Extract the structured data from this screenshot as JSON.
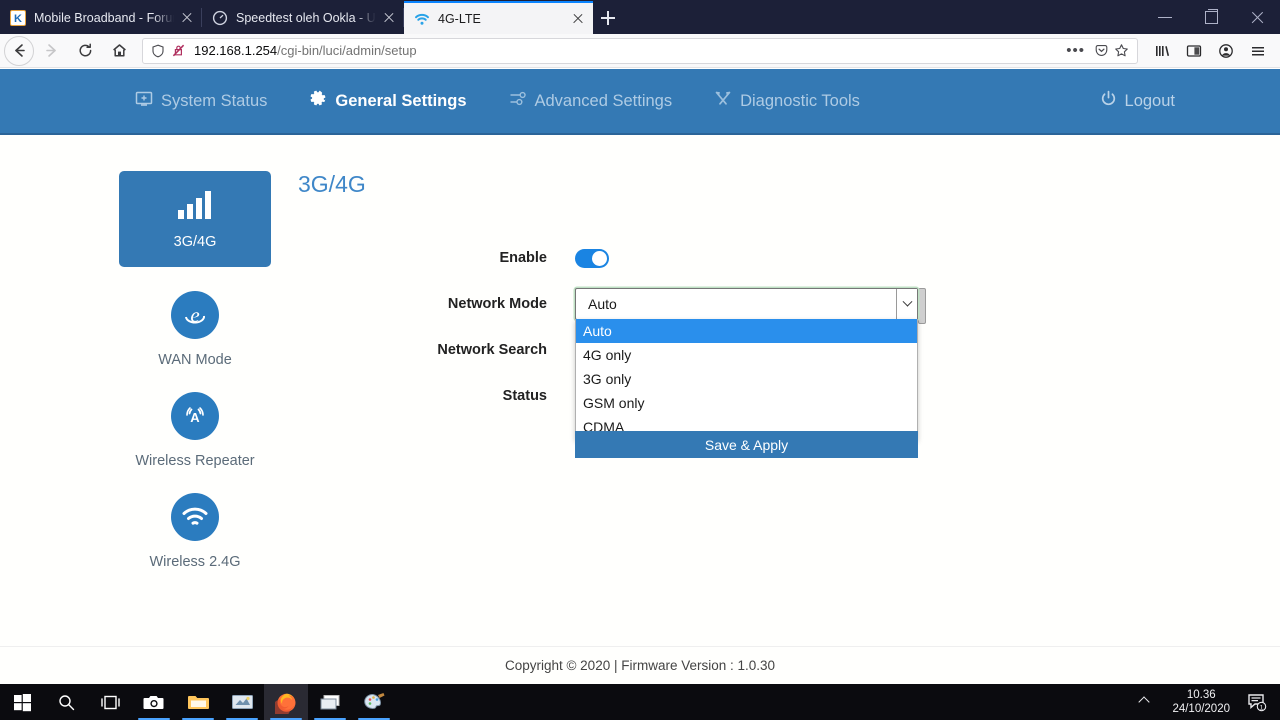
{
  "browser": {
    "tabs": [
      {
        "title": "Mobile Broadband - Forum | K",
        "favicon": "k-logo-icon",
        "active": false
      },
      {
        "title": "Speedtest oleh Ookla - Uji Kece",
        "favicon": "speedtest-icon",
        "active": false
      },
      {
        "title": "4G-LTE",
        "favicon": "wifi-icon",
        "active": true
      }
    ],
    "new_tab_label": "+",
    "window_controls": {
      "minimize": "minimize",
      "maximize": "restore",
      "close": "close"
    },
    "nav": {
      "back": "back-arrow",
      "forward": "forward-arrow",
      "reload": "reload",
      "home": "home"
    },
    "url": {
      "host": "192.168.1.254",
      "path": "/cgi-bin/luci/admin/setup",
      "shield": "shield-icon",
      "lock": "lock-broken-icon"
    },
    "toolbar_right": [
      "library-icon",
      "sidebar-icon",
      "account-icon",
      "menu-icon"
    ]
  },
  "app": {
    "nav": [
      {
        "label": "System Status",
        "icon": "monitor-icon",
        "active": false
      },
      {
        "label": "General Settings",
        "icon": "gear-icon",
        "active": true
      },
      {
        "label": "Advanced Settings",
        "icon": "sliders-icon",
        "active": false
      },
      {
        "label": "Diagnostic Tools",
        "icon": "tools-icon",
        "active": false
      }
    ],
    "logout": {
      "label": "Logout",
      "icon": "power-icon"
    },
    "sidebar": [
      {
        "label": "3G/4G",
        "icon": "signal-bars-icon",
        "active": true
      },
      {
        "label": "WAN Mode",
        "icon": "browser-e-icon",
        "active": false
      },
      {
        "label": "Wireless Repeater",
        "icon": "broadcast-tower-icon",
        "active": false
      },
      {
        "label": "Wireless 2.4G",
        "icon": "wifi-icon",
        "active": false
      }
    ],
    "page_title": "3G/4G",
    "form": {
      "enable": {
        "label": "Enable",
        "state": "on"
      },
      "network_mode": {
        "label": "Network Mode",
        "value": "Auto",
        "options": [
          "Auto",
          "4G only",
          "3G only",
          "GSM only",
          "CDMA"
        ],
        "selected_index": 0,
        "expanded": true
      },
      "network_search": {
        "label": "Network Search"
      },
      "status": {
        "label": "Status"
      },
      "save_button": "Save & Apply"
    },
    "footer": "Copyright © 2020  |  Firmware Version : 1.0.30",
    "colors": {
      "header_blue": "#3479b4",
      "accent_blue": "#2a8fec",
      "title_blue": "#3f87c8"
    }
  },
  "taskbar": {
    "icons": [
      "windows-start-icon",
      "search-icon",
      "task-view-icon",
      "camera-icon",
      "file-explorer-icon",
      "media-player-icon",
      "firefox-icon",
      "window-switcher-icon",
      "paint-icon"
    ],
    "tray": {
      "expand": "chevron-up-icon",
      "time": "10.36",
      "date": "24/10/2020",
      "notifications_icon": "notification-icon",
      "notifications_count": "1"
    }
  }
}
